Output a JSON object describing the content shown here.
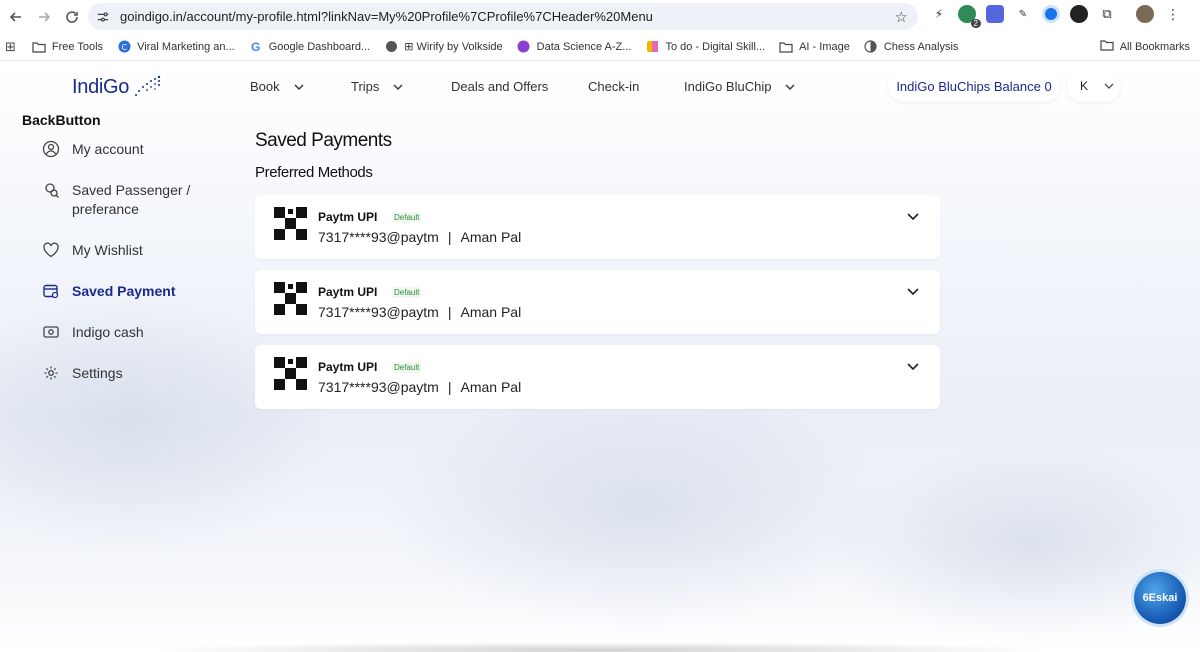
{
  "browser": {
    "url": "goindigo.in/account/my-profile.html?linkNav=My%20Profile%7CProfile%7CHeader%20Menu",
    "extension_badge": "2",
    "bookmarks": [
      {
        "label": "Free Tools",
        "icon": "folder-icon"
      },
      {
        "label": "Viral Marketing an...",
        "icon": "site-c-icon"
      },
      {
        "label": "Google Dashboard...",
        "icon": "google-icon"
      },
      {
        "label": "⊞ Wirify by Volkside",
        "icon": "globe-icon"
      },
      {
        "label": "Data Science A-Z...",
        "icon": "site-ds-icon"
      },
      {
        "label": "To do - Digital Skill...",
        "icon": "todo-icon"
      },
      {
        "label": "AI - Image",
        "icon": "folder-icon"
      },
      {
        "label": "Chess Analysis",
        "icon": "chess-icon"
      }
    ],
    "all_bookmarks": "All Bookmarks"
  },
  "header": {
    "logo": "IndiGo",
    "menu": [
      {
        "label": "Book",
        "has_dropdown": true
      },
      {
        "label": "Trips",
        "has_dropdown": true
      },
      {
        "label": "Deals and Offers",
        "has_dropdown": false
      },
      {
        "label": "Check-in",
        "has_dropdown": false
      },
      {
        "label": "IndiGo BluChip",
        "has_dropdown": true
      }
    ],
    "balance": "IndiGo BluChips Balance 0",
    "user_initial": "K"
  },
  "sidebar": {
    "back": "BackButton",
    "items": [
      {
        "label": "My account",
        "icon": "user-circle-icon",
        "active": false
      },
      {
        "label": "Saved Passenger / preferance",
        "icon": "passenger-icon",
        "active": false
      },
      {
        "label": "My Wishlist",
        "icon": "heart-icon",
        "active": false
      },
      {
        "label": "Saved Payment",
        "icon": "wallet-icon",
        "active": true
      },
      {
        "label": "Indigo cash",
        "icon": "cash-icon",
        "active": false
      },
      {
        "label": "Settings",
        "icon": "gear-icon",
        "active": false
      }
    ]
  },
  "main": {
    "title": "Saved Payments",
    "subtitle": "Preferred Methods",
    "payments": [
      {
        "name": "Paytm UPI",
        "badge": "Default",
        "id": "7317****93@paytm",
        "separator": "|",
        "holder": "Aman Pal"
      },
      {
        "name": "Paytm UPI",
        "badge": "Default",
        "id": "7317****93@paytm",
        "separator": "|",
        "holder": "Aman Pal"
      },
      {
        "name": "Paytm UPI",
        "badge": "Default",
        "id": "7317****93@paytm",
        "separator": "|",
        "holder": "Aman Pal"
      }
    ]
  },
  "chatbot": {
    "label": "6Eskai"
  },
  "colors": {
    "brand": "#1a2a8c",
    "default_badge": "#2e8b3a"
  }
}
